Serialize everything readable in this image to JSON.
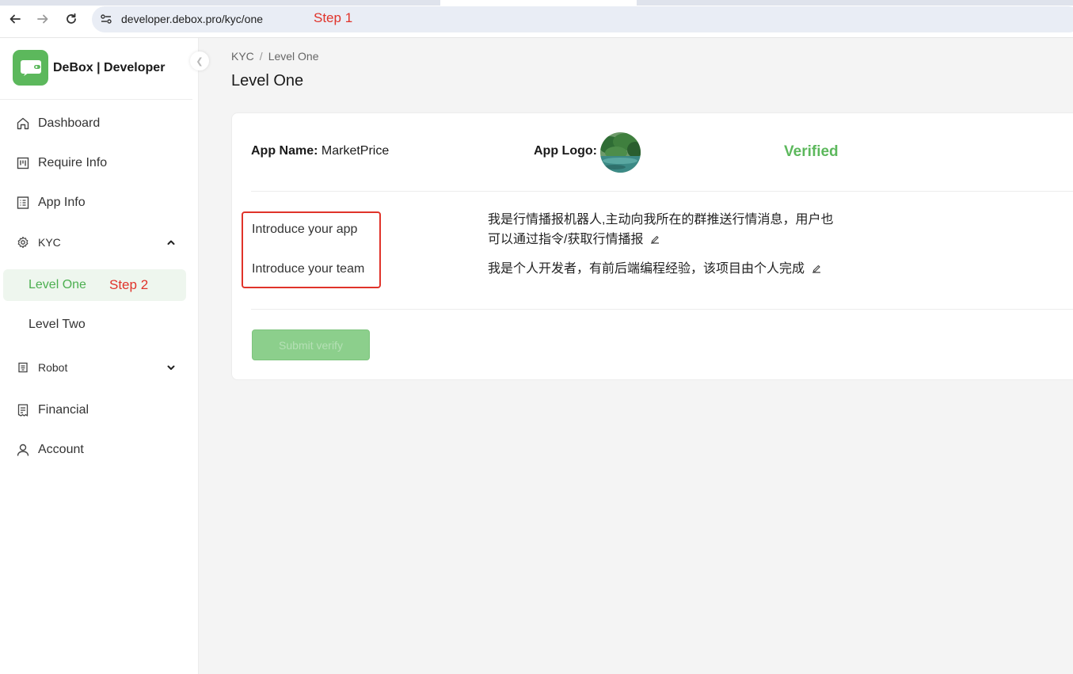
{
  "browser": {
    "url": "developer.debox.pro/kyc/one",
    "annotation": "Step 1"
  },
  "sidebar": {
    "brand": "DeBox | Developer",
    "items": [
      {
        "label": "Dashboard",
        "icon": "home-icon"
      },
      {
        "label": "Require Info",
        "icon": "board-icon"
      },
      {
        "label": "App Info",
        "icon": "list-icon"
      },
      {
        "label": "KYC",
        "icon": "gear-icon",
        "expanded": true
      },
      {
        "label": "Robot",
        "icon": "robot-icon",
        "expanded": false
      },
      {
        "label": "Financial",
        "icon": "receipt-icon"
      },
      {
        "label": "Account",
        "icon": "user-icon"
      }
    ],
    "kyc_sub": [
      {
        "label": "Level One",
        "active": true
      },
      {
        "label": "Level Two",
        "active": false
      }
    ],
    "annotation": "Step 2"
  },
  "main": {
    "breadcrumb": [
      "KYC",
      "Level One"
    ],
    "title": "Level One",
    "app_name_label": "App Name:",
    "app_name": "MarketPrice",
    "app_logo_label": "App Logo:",
    "status": "Verified",
    "fields": [
      {
        "label": "Introduce your app",
        "value_line1": "我是行情播报机器人,主动向我所在的群推送行情消息，用户也",
        "value_line2": "可以通过指令/获取行情播报"
      },
      {
        "label": "Introduce your team",
        "value": "我是个人开发者，有前后端编程经验，该项目由个人完成"
      }
    ],
    "submit_label": "Submit verify"
  },
  "colors": {
    "accent": "#5cb85c",
    "annotation": "#e0332a"
  }
}
